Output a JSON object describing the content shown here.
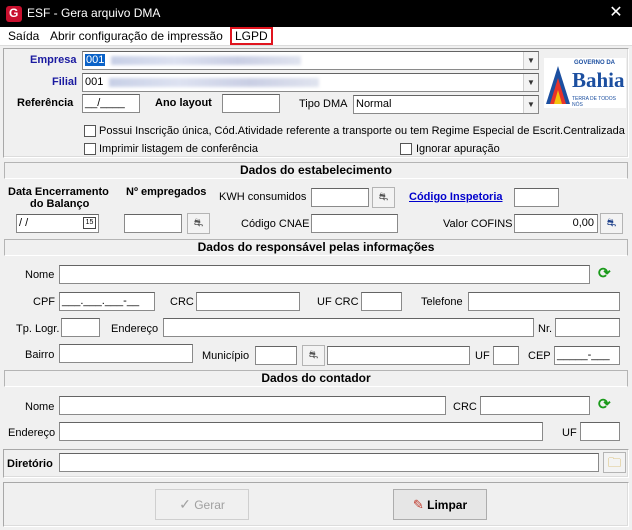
{
  "window": {
    "title": "ESF - Gera arquivo DMA",
    "close": "✕"
  },
  "menu": {
    "items": [
      "Saída",
      "Abrir configuração de impressão",
      "LGPD"
    ]
  },
  "header": {
    "empresa_label": "Empresa",
    "empresa_value": "001",
    "filial_label": "Filial",
    "filial_value": "001",
    "referencia_label": "Referência",
    "referencia_value": "__/____",
    "ano_layout_label": "Ano layout",
    "ano_layout_value": "",
    "tipo_dma_label": "Tipo DMA",
    "tipo_dma_value": "Normal",
    "logo_top": "GOVERNO DA",
    "logo_main": "Bahia",
    "logo_sub": "TERRA DE TODOS NÓS"
  },
  "options": {
    "inscricao_unica": "Possui Inscrição única, Cód.Atividade referente a transporte ou tem Regime Especial de Escrit.Centralizada",
    "imprimir_listagem": "Imprimir listagem de conferência",
    "ignorar_apuracao": "Ignorar apuração"
  },
  "estabelecimento": {
    "heading": "Dados do estabelecimento",
    "data_encerramento_label_1": "Data Encerramento",
    "data_encerramento_label_2": "do Balanço",
    "data_encerramento_value": " / /",
    "empregados_label": "Nº empregados",
    "kwh_label": "KWH consumidos",
    "codigo_inspetoria_label": "Código Inspetoria",
    "cnae_label": "Código CNAE",
    "cofins_label": "Valor COFINS",
    "cofins_value": "0,00"
  },
  "responsavel": {
    "heading": "Dados do responsável pelas informações",
    "nome_label": "Nome",
    "cpf_label": "CPF",
    "cpf_value": "___.___.___-__",
    "crc_label": "CRC",
    "uf_crc_label": "UF CRC",
    "telefone_label": "Telefone",
    "tp_logr_label": "Tp. Logr.",
    "endereco_label": "Endereço",
    "nr_label": "Nr.",
    "bairro_label": "Bairro",
    "municipio_label": "Município",
    "uf_label": "UF",
    "cep_label": "CEP",
    "cep_value": "_____-___"
  },
  "contador": {
    "heading": "Dados do contador",
    "nome_label": "Nome",
    "crc_label": "CRC",
    "endereco_label": "Endereço",
    "uf_label": "UF"
  },
  "diretorio": {
    "label": "Diretório"
  },
  "buttons": {
    "gerar": "Gerar",
    "limpar": "Limpar"
  }
}
